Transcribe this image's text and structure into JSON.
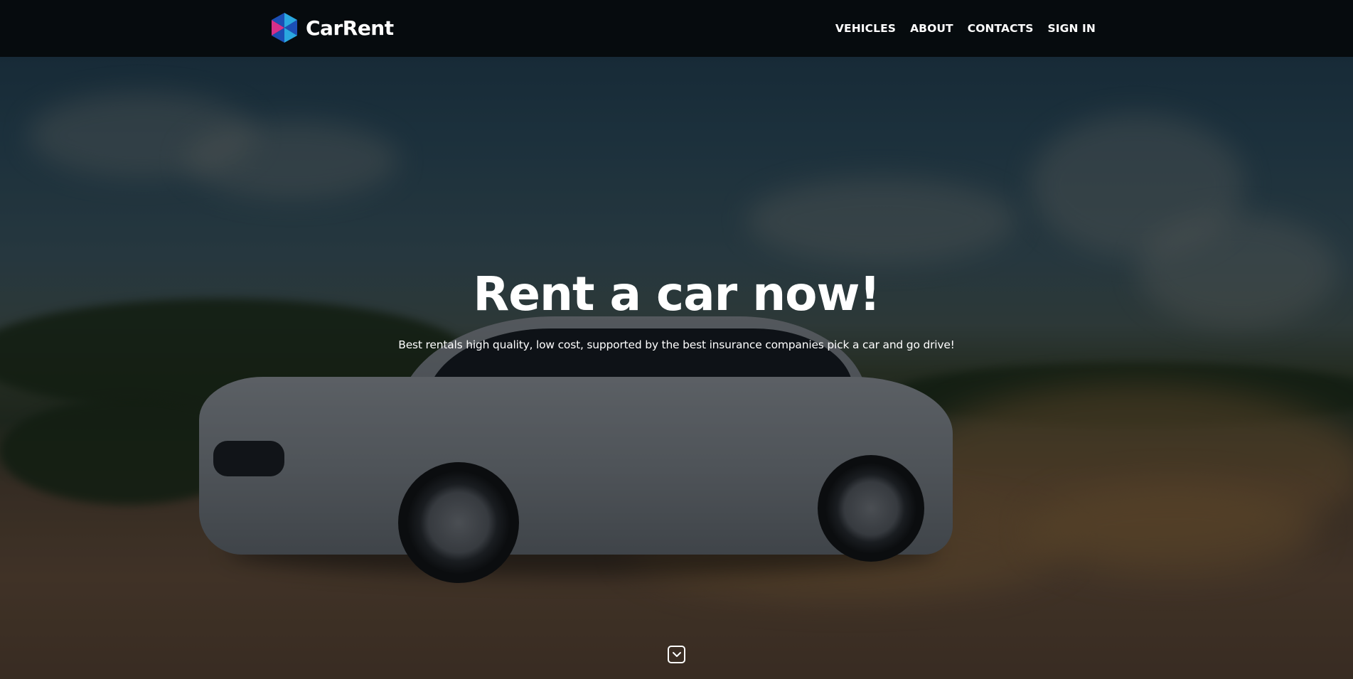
{
  "brand": {
    "name": "CarRent",
    "logo_icon": "hexagon-star-logo-icon"
  },
  "nav": {
    "items": [
      {
        "label": "VEHICLES"
      },
      {
        "label": "ABOUT"
      },
      {
        "label": "CONTACTS"
      },
      {
        "label": "SIGN IN"
      }
    ]
  },
  "hero": {
    "title": "Rent a car now!",
    "subtitle": "Best rentals high quality, low cost, supported by the best insurance companies pick a car and go drive!",
    "background_image": "white sedan drifting on dirt road with dust cloud",
    "scroll_icon": "chevron-down-icon"
  },
  "colors": {
    "navbar_bg": "#060b0e",
    "text": "#ffffff",
    "logo_cyan": "#2aa8e0",
    "logo_magenta": "#d6308a",
    "logo_blue": "#1b4fb5"
  }
}
